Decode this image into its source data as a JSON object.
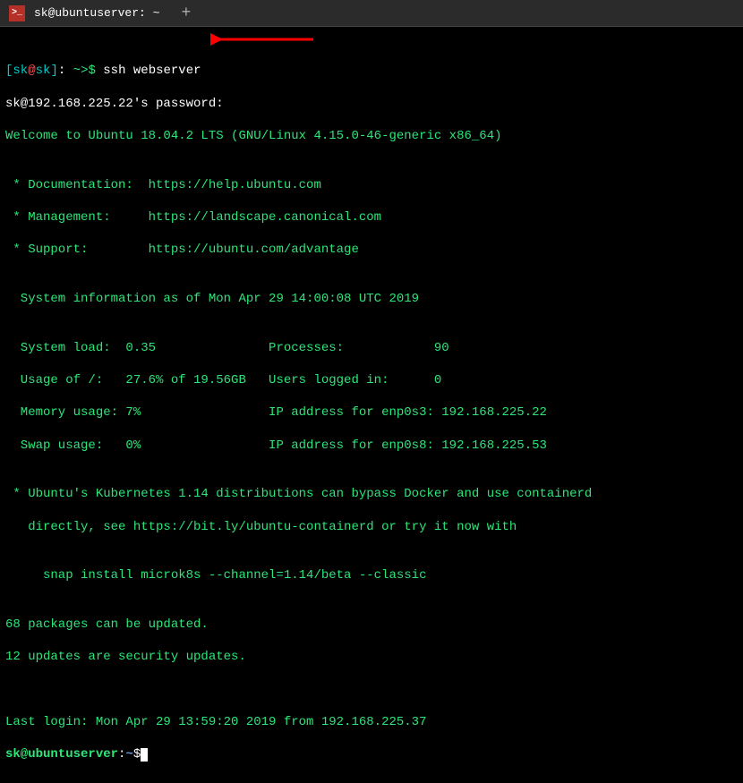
{
  "titlebar": {
    "tab_title": "sk@ubuntuserver: ~",
    "tab_icon_glyph": ">_",
    "new_tab_glyph": "+"
  },
  "prompt1": {
    "open_bracket": "[",
    "user": "sk",
    "at": "@",
    "host": "sk",
    "close_bracket": "]",
    "colon": ":",
    "path": " ~",
    "suffix": ">$ ",
    "command": "ssh webserver"
  },
  "lines": {
    "pw": "sk@192.168.225.22's password:",
    "welcome": "Welcome to Ubuntu 18.04.2 LTS (GNU/Linux 4.15.0-46-generic x86_64)",
    "blank": "",
    "doc": " * Documentation:  https://help.ubuntu.com",
    "mgmt": " * Management:     https://landscape.canonical.com",
    "support": " * Support:        https://ubuntu.com/advantage",
    "sysinfo": "  System information as of Mon Apr 29 14:00:08 UTC 2019",
    "r1": "  System load:  0.35               Processes:            90",
    "r2": "  Usage of /:   27.6% of 19.56GB   Users logged in:      0",
    "r3": "  Memory usage: 7%                 IP address for enp0s3: 192.168.225.22",
    "r4": "  Swap usage:   0%                 IP address for enp0s8: 192.168.225.53",
    "k8s1": " * Ubuntu's Kubernetes 1.14 distributions can bypass Docker and use containerd",
    "k8s2": "   directly, see https://bit.ly/ubuntu-containerd or try it now with",
    "snap": "     snap install microk8s --channel=1.14/beta --classic",
    "pkg1": "68 packages can be updated.",
    "pkg2": "12 updates are security updates.",
    "last": "Last login: Mon Apr 29 13:59:20 2019 from 192.168.225.37"
  },
  "prompt2": {
    "userhost": "sk@ubuntuserver",
    "colon": ":",
    "path": "~",
    "dollar": "$"
  }
}
